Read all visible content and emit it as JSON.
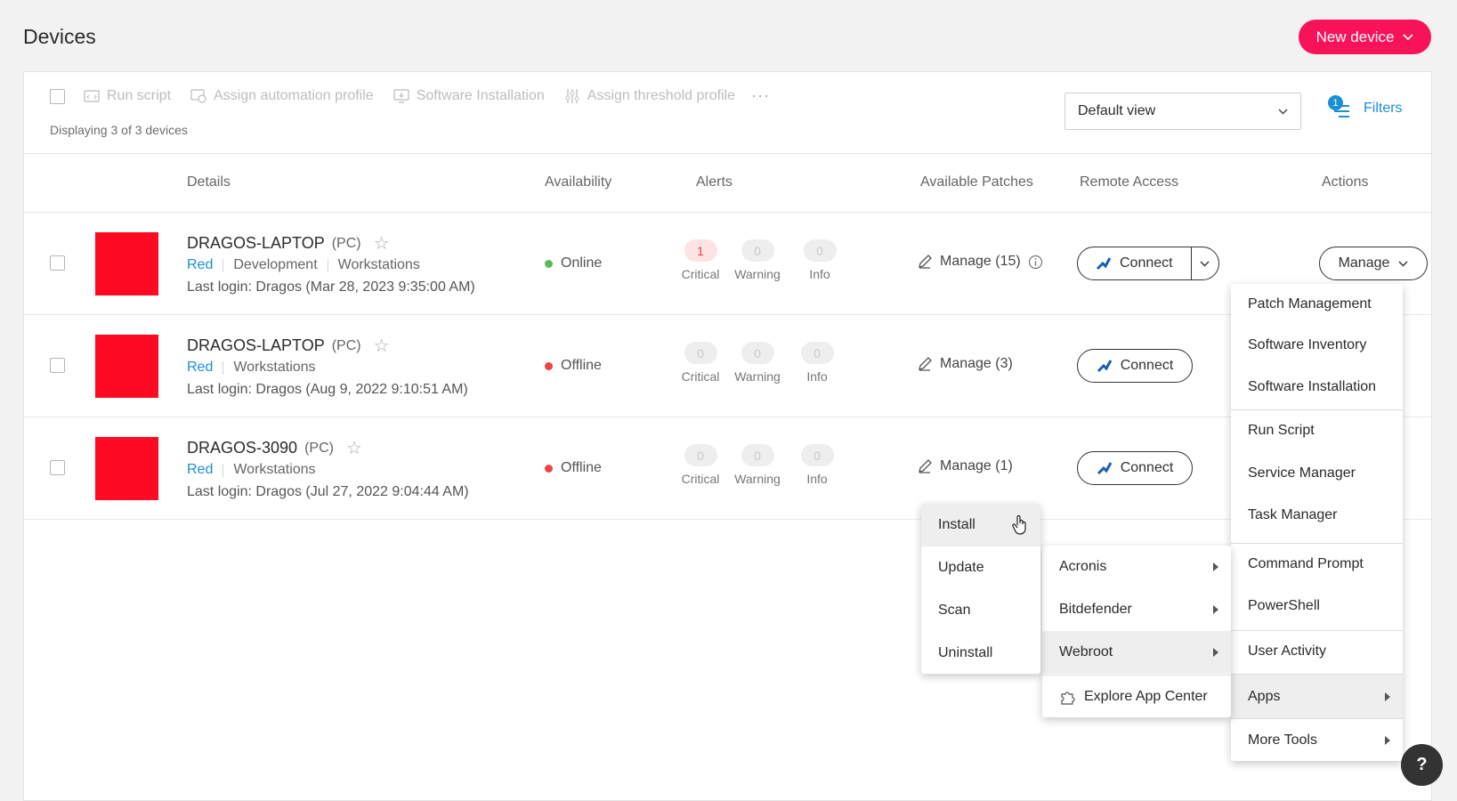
{
  "page": {
    "title": "Devices"
  },
  "new_device": {
    "label": "New device"
  },
  "toolbar": {
    "actions": [
      "Run script",
      "Assign automation profile",
      "Software Installation",
      "Assign threshold profile"
    ],
    "more": "···",
    "displaying": "Displaying 3 of 3 devices",
    "view_select": "Default view",
    "filters_label": "Filters",
    "filters_count": "1"
  },
  "headers": {
    "details": "Details",
    "availability": "Availability",
    "alerts": "Alerts",
    "patches": "Available Patches",
    "remote": "Remote Access",
    "actions": "Actions"
  },
  "devices": [
    {
      "name": "DRAGOS-LAPTOP",
      "type": "(PC)",
      "tag": "Red",
      "groups": [
        "Development",
        "Workstations"
      ],
      "login": "Last login: Dragos (Mar 28, 2023 9:35:00 AM)",
      "status": "Online",
      "status_color": "#5cb85c",
      "critical": "1",
      "warning": "0",
      "info": "0",
      "patches": "Manage  (15)",
      "connect": "Connect"
    },
    {
      "name": "DRAGOS-LAPTOP",
      "type": "(PC)",
      "tag": "Red",
      "groups": [
        "Workstations"
      ],
      "login": "Last login: Dragos (Aug 9, 2022 9:10:51 AM)",
      "status": "Offline",
      "status_color": "#ee4444",
      "critical": "0",
      "warning": "0",
      "info": "0",
      "patches": "Manage  (3)",
      "connect": "Connect"
    },
    {
      "name": "DRAGOS-3090",
      "type": "(PC)",
      "tag": "Red",
      "groups": [
        "Workstations"
      ],
      "login": "Last login: Dragos (Jul 27, 2022 9:04:44 AM)",
      "status": "Offline",
      "status_color": "#ee4444",
      "critical": "0",
      "warning": "0",
      "info": "0",
      "patches": "Manage  (1)",
      "connect": "Connect"
    }
  ],
  "alert_labels": {
    "critical": "Critical",
    "warning": "Warning",
    "info": "Info"
  },
  "manage_label": "Manage",
  "manage_menu": [
    "Patch Management",
    "Software Inventory",
    "Software Installation",
    "Run Script",
    "Service Manager",
    "Task Manager",
    "Command Prompt",
    "PowerShell",
    "User Activity",
    "Apps",
    "More Tools"
  ],
  "apps_menu": [
    "Acronis",
    "Bitdefender",
    "Webroot",
    "Explore App Center"
  ],
  "webroot_menu": [
    "Install",
    "Update",
    "Scan",
    "Uninstall"
  ],
  "colors": {
    "brand": "#f7125a",
    "link": "#1a8fd6",
    "device_thumb": "#ff0a23"
  }
}
